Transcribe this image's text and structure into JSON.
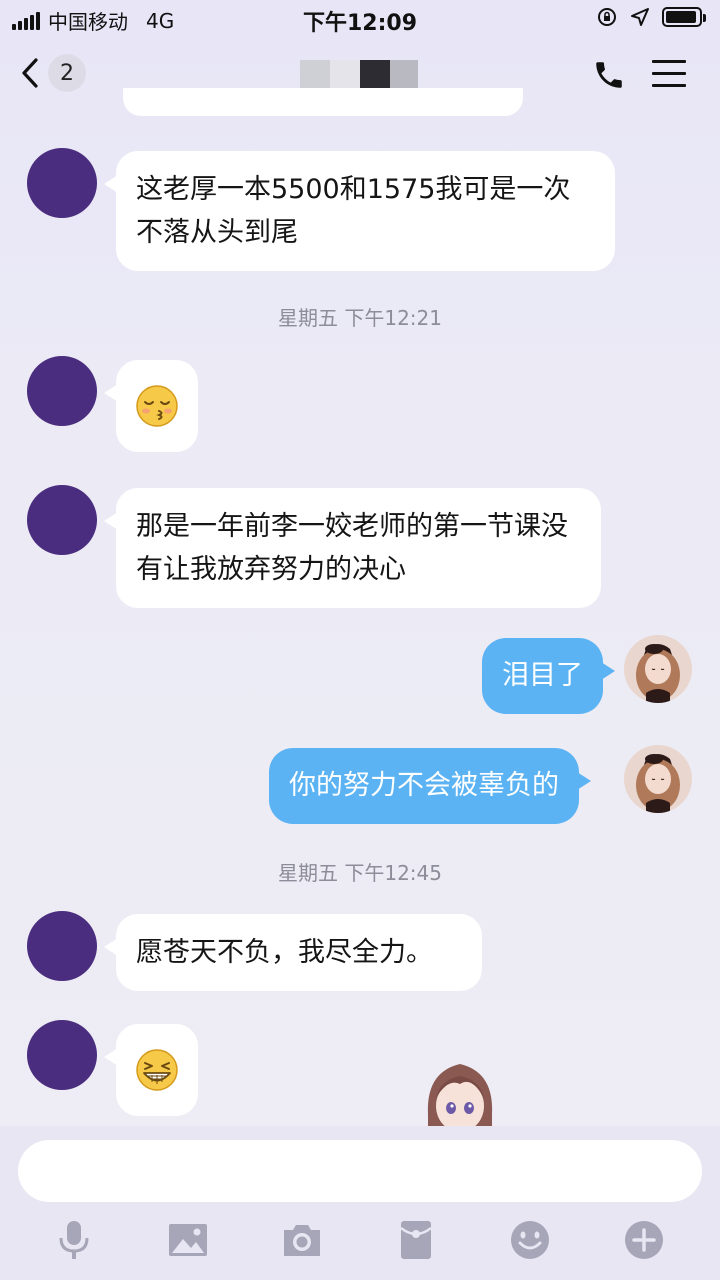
{
  "status_bar": {
    "carrier": "中国移动",
    "network": "4G",
    "time": "下午12:09",
    "battery_level": 0.95
  },
  "nav": {
    "back_unread": "2",
    "title_colors": [
      "#cfcfd6",
      "#e4e4ea",
      "#2c2c32",
      "#b9b9c1"
    ]
  },
  "colors": {
    "accent_blue": "#5cb3f3",
    "avatar_purple": "#4a2d7e"
  },
  "messages": [
    {
      "side": "in",
      "text": "这老厚一本5500和1575我可是一次不落从头到尾"
    },
    {
      "type": "timestamp",
      "text": "星期五 下午12:21"
    },
    {
      "side": "in",
      "emoji": "kiss-face-icon"
    },
    {
      "side": "in",
      "text": "那是一年前李一姣老师的第一节课没有让我放弃努力的决心"
    },
    {
      "side": "out",
      "text": "泪目了"
    },
    {
      "side": "out",
      "text": "你的努力不会被辜负的"
    },
    {
      "type": "timestamp",
      "text": "星期五 下午12:45"
    },
    {
      "side": "in",
      "text": "愿苍天不负，我尽全力。"
    },
    {
      "side": "in",
      "emoji": "grin-face-icon"
    }
  ],
  "toolbar": [
    "microphone-icon",
    "image-icon",
    "camera-icon",
    "red-packet-icon",
    "emoji-icon",
    "plus-icon"
  ]
}
